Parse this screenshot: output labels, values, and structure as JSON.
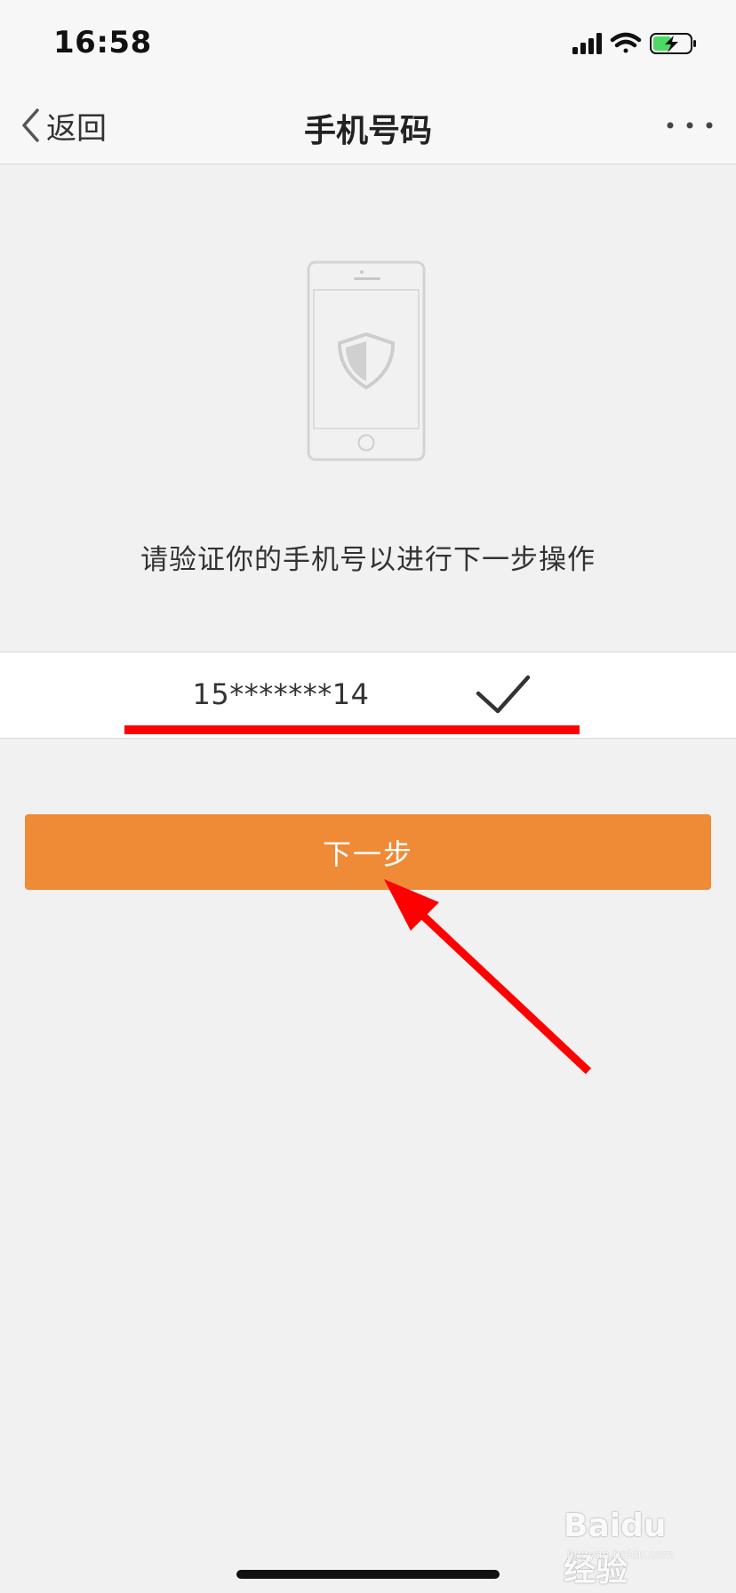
{
  "status_bar": {
    "time": "16:58",
    "icons": [
      "signal-icon",
      "wifi-icon",
      "battery-charging-icon"
    ]
  },
  "nav": {
    "back_label": "返回",
    "title": "手机号码",
    "more_icon": "more-dots-icon"
  },
  "illustration": {
    "icon": "phone-shield-icon"
  },
  "prompt": "请验证你的手机号以进行下一步操作",
  "phone_field": {
    "value": "15*******14",
    "status_icon": "checkmark-icon"
  },
  "next_button": {
    "label": "下一步",
    "color": "#ef8a36"
  },
  "annotation": {
    "underline_color": "#fe0000",
    "arrow_color": "#fe0000"
  },
  "watermark": {
    "logo": "Baidu经验",
    "url": "jingyan.baidu.com"
  }
}
